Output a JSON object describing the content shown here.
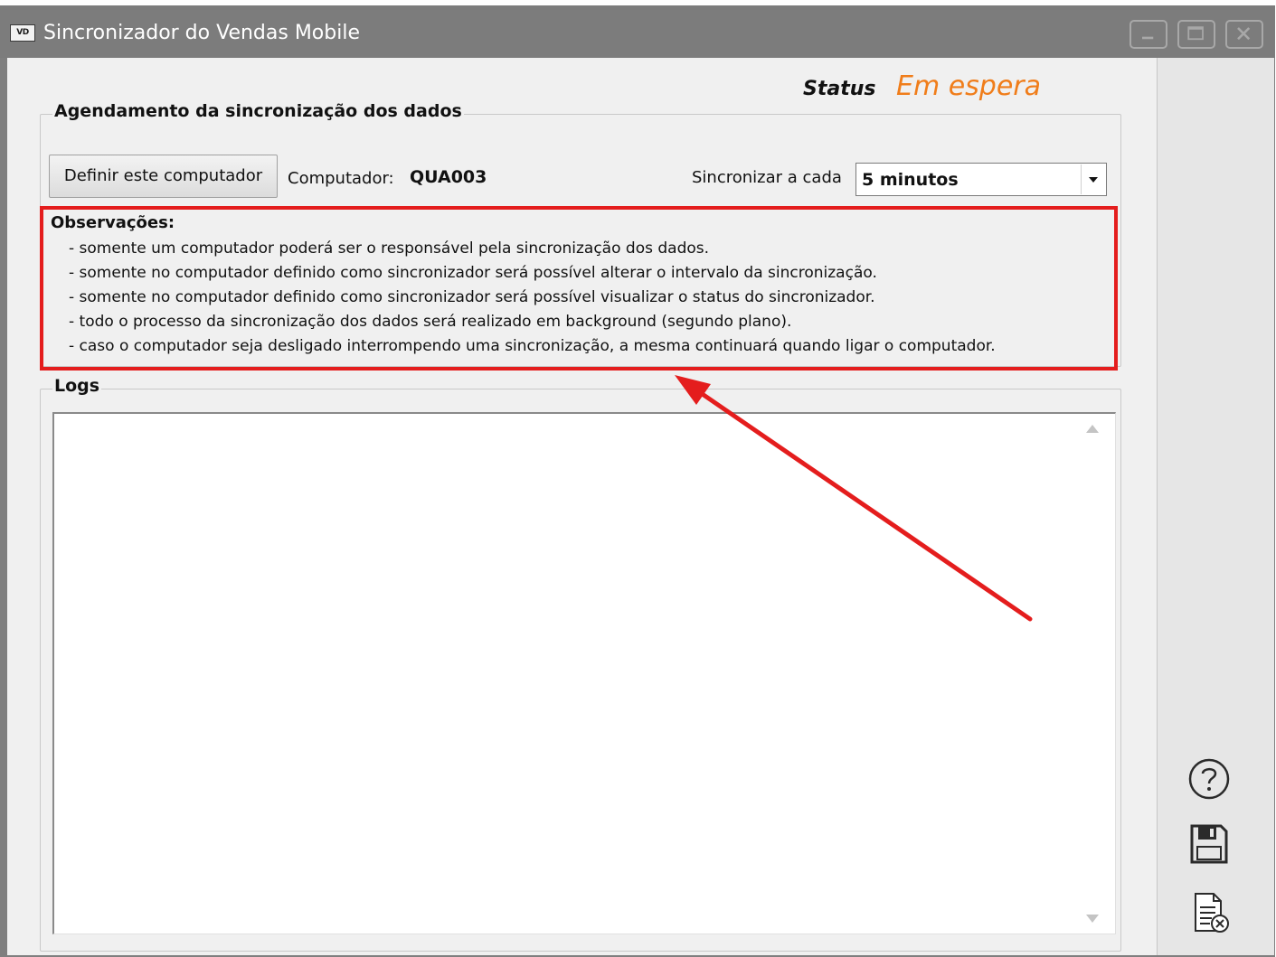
{
  "window": {
    "app_icon_text": "VD",
    "title": "Sincronizador do Vendas Mobile"
  },
  "status": {
    "label": "Status",
    "value": "Em espera",
    "value_color": "#f07d1a"
  },
  "schedule": {
    "group_title": "Agendamento da sincronização dos dados",
    "define_button": "Definir este computador",
    "computer_label": "Computador:",
    "computer_value": "QUA003",
    "sync_label": "Sincronizar a cada",
    "sync_value": "5 minutos"
  },
  "observations": {
    "title": "Observações:",
    "items": [
      "- somente um computador poderá ser o responsável pela sincronização dos dados.",
      "- somente no computador definido como sincronizador será possível alterar o intervalo da sincronização.",
      "- somente no computador definido como sincronizador será possível visualizar o status do sincronizador.",
      "- todo o processo da sincronização dos dados será realizado em background (segundo plano).",
      "- caso o computador seja desligado interrompendo uma sincronização, a mesma continuará quando ligar o computador."
    ],
    "highlight_color": "#e41d1d"
  },
  "logs": {
    "group_title": "Logs"
  },
  "sidebar": {
    "icons": [
      "help-icon",
      "save-icon",
      "clear-log-icon"
    ]
  }
}
